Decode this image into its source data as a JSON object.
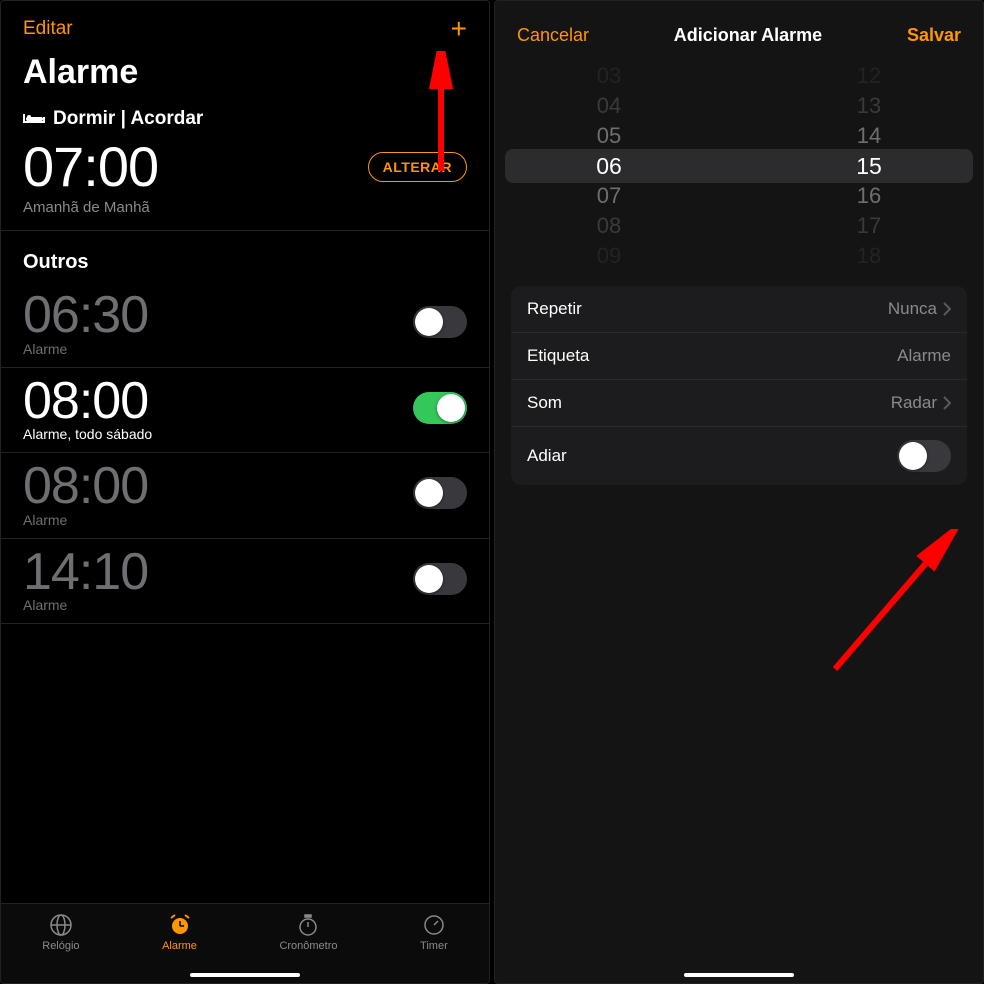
{
  "left": {
    "nav": {
      "edit": "Editar",
      "add": "+"
    },
    "title": "Alarme",
    "sleep": {
      "heading": "Dormir | Acordar",
      "time": "07:00",
      "change": "ALTERAR",
      "subtitle": "Amanhã de Manhã"
    },
    "others_title": "Outros",
    "alarms": [
      {
        "time": "06:30",
        "label": "Alarme",
        "on": false
      },
      {
        "time": "08:00",
        "label": "Alarme, todo sábado",
        "on": true
      },
      {
        "time": "08:00",
        "label": "Alarme",
        "on": false
      },
      {
        "time": "14:10",
        "label": "Alarme",
        "on": false
      }
    ],
    "tabs": [
      {
        "id": "relogio",
        "label": "Relógio",
        "active": false
      },
      {
        "id": "alarme",
        "label": "Alarme",
        "active": true
      },
      {
        "id": "cronometro",
        "label": "Cronômetro",
        "active": false
      },
      {
        "id": "timer",
        "label": "Timer",
        "active": false
      }
    ]
  },
  "right": {
    "nav": {
      "cancel": "Cancelar",
      "title": "Adicionar Alarme",
      "save": "Salvar"
    },
    "picker": {
      "hours": [
        "03",
        "04",
        "05",
        "06",
        "07",
        "08",
        "09"
      ],
      "minutes": [
        "12",
        "13",
        "14",
        "15",
        "16",
        "17",
        "18"
      ],
      "selected_hour_index": 3,
      "selected_minute_index": 3
    },
    "settings": {
      "repeat": {
        "label": "Repetir",
        "value": "Nunca",
        "chevron": true
      },
      "tag": {
        "label": "Etiqueta",
        "value": "Alarme",
        "chevron": false
      },
      "sound": {
        "label": "Som",
        "value": "Radar",
        "chevron": true
      },
      "snooze": {
        "label": "Adiar",
        "on": false
      }
    }
  },
  "colors": {
    "accent": "#ff9500",
    "toggle_on": "#34c759"
  }
}
